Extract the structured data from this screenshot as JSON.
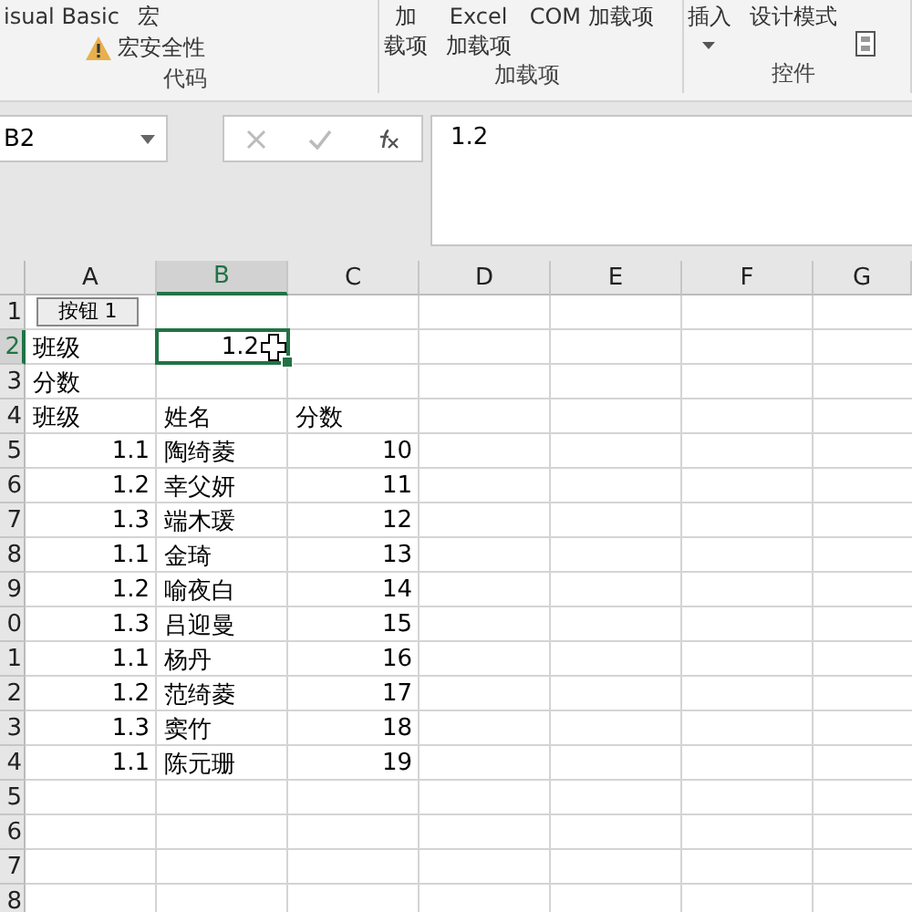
{
  "ribbon": {
    "groups": [
      {
        "label": "代码",
        "items": [
          {
            "kind": "text",
            "label": "isual Basic"
          },
          {
            "kind": "text",
            "label": "宏"
          },
          {
            "kind": "warn",
            "label": "宏安全性"
          }
        ]
      },
      {
        "label": "加载项",
        "items": [
          {
            "kind": "stack",
            "label": "加",
            "label2": "载项"
          },
          {
            "kind": "stack",
            "label": "Excel",
            "label2": "加载项"
          },
          {
            "kind": "text",
            "label": "COM 加载项"
          }
        ]
      },
      {
        "label": "控件",
        "items": [
          {
            "kind": "caret",
            "label": "插入"
          },
          {
            "kind": "text",
            "label": "设计模式"
          },
          {
            "kind": "iconbtn"
          }
        ]
      }
    ]
  },
  "name_box": {
    "value": "B2"
  },
  "formula": {
    "value": "1.2"
  },
  "columns": [
    {
      "label": "A",
      "selected": false
    },
    {
      "label": "B",
      "selected": true
    },
    {
      "label": "C",
      "selected": false
    },
    {
      "label": "D",
      "selected": false
    },
    {
      "label": "E",
      "selected": false
    },
    {
      "label": "F",
      "selected": false
    },
    {
      "label": "G",
      "selected": false
    }
  ],
  "form_button": {
    "label": "按钮 1"
  },
  "rows": [
    {
      "label": "1",
      "selected": false,
      "cells": [
        "",
        "",
        "",
        "",
        "",
        "",
        ""
      ]
    },
    {
      "label": "2",
      "selected": true,
      "cells": [
        "班级",
        "1.2",
        "",
        "",
        "",
        "",
        ""
      ]
    },
    {
      "label": "3",
      "selected": false,
      "cells": [
        "分数",
        "",
        "",
        "",
        "",
        "",
        ""
      ]
    },
    {
      "label": "4",
      "selected": false,
      "cells": [
        "班级",
        "姓名",
        "分数",
        "",
        "",
        "",
        ""
      ]
    },
    {
      "label": "5",
      "selected": false,
      "cells": [
        "1.1",
        "陶绮菱",
        "10",
        "",
        "",
        "",
        ""
      ]
    },
    {
      "label": "6",
      "selected": false,
      "cells": [
        "1.2",
        "幸父妍",
        "11",
        "",
        "",
        "",
        ""
      ]
    },
    {
      "label": "7",
      "selected": false,
      "cells": [
        "1.3",
        "端木瑗",
        "12",
        "",
        "",
        "",
        ""
      ]
    },
    {
      "label": "8",
      "selected": false,
      "cells": [
        "1.1",
        "金琦",
        "13",
        "",
        "",
        "",
        ""
      ]
    },
    {
      "label": "9",
      "selected": false,
      "cells": [
        "1.2",
        "喻夜白",
        "14",
        "",
        "",
        "",
        ""
      ]
    },
    {
      "label": "0",
      "selected": false,
      "cells": [
        "1.3",
        "吕迎曼",
        "15",
        "",
        "",
        "",
        ""
      ]
    },
    {
      "label": "1",
      "selected": false,
      "cells": [
        "1.1",
        "杨丹",
        "16",
        "",
        "",
        "",
        ""
      ]
    },
    {
      "label": "2",
      "selected": false,
      "cells": [
        "1.2",
        "范绮菱",
        "17",
        "",
        "",
        "",
        ""
      ]
    },
    {
      "label": "3",
      "selected": false,
      "cells": [
        "1.3",
        "窦竹",
        "18",
        "",
        "",
        "",
        ""
      ]
    },
    {
      "label": "4",
      "selected": false,
      "cells": [
        "1.1",
        "陈元珊",
        "19",
        "",
        "",
        "",
        ""
      ]
    },
    {
      "label": "5",
      "selected": false,
      "cells": [
        "",
        "",
        "",
        "",
        "",
        "",
        ""
      ]
    },
    {
      "label": "6",
      "selected": false,
      "cells": [
        "",
        "",
        "",
        "",
        "",
        "",
        ""
      ]
    },
    {
      "label": "7",
      "selected": false,
      "cells": [
        "",
        "",
        "",
        "",
        "",
        "",
        ""
      ]
    },
    {
      "label": "8",
      "selected": false,
      "cells": [
        "",
        "",
        "",
        "",
        "",
        "",
        ""
      ]
    }
  ]
}
